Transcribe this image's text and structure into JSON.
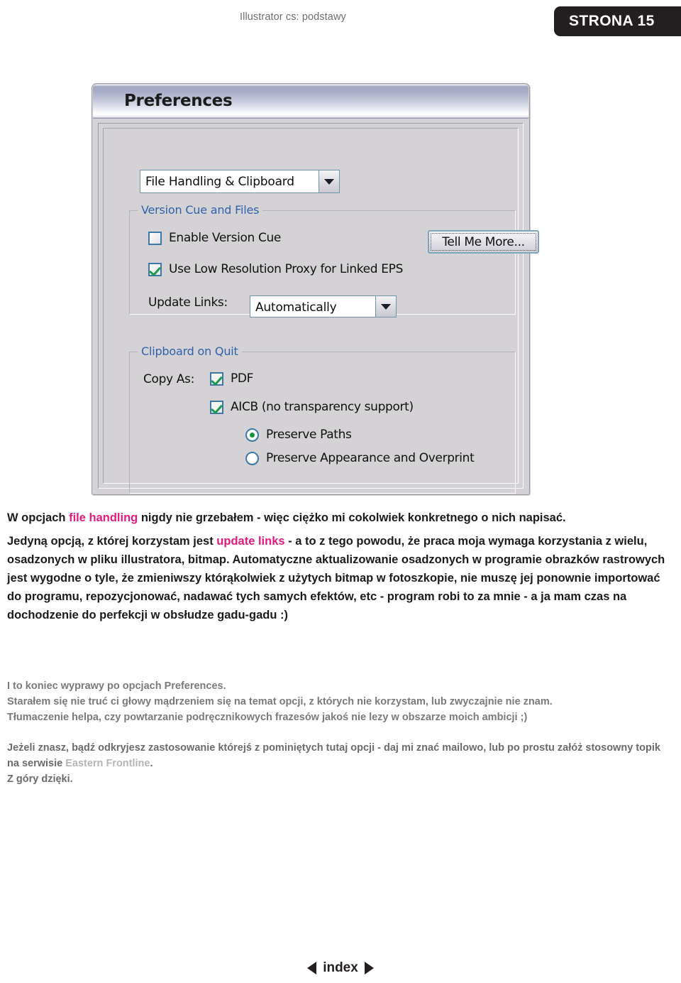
{
  "header": {
    "title": "Illustrator cs: podstawy",
    "page_badge": "STRONA 15"
  },
  "dialog": {
    "title": "Preferences",
    "category_combo": {
      "value": "File Handling & Clipboard",
      "arrow_icon": "chevron-down-icon"
    },
    "groups": [
      {
        "legend": "Version Cue and Files",
        "controls": [
          {
            "type": "checkbox",
            "label": "Enable Version Cue",
            "checked": false
          },
          {
            "type": "checkbox",
            "label": "Use Low Resolution Proxy for Linked EPS",
            "checked": true
          },
          {
            "type": "label",
            "label": "Update Links:"
          }
        ],
        "button": {
          "label": "Tell Me More..."
        },
        "update_links_value": "Automatically"
      },
      {
        "legend": "Clipboard on Quit",
        "copy_as_label": "Copy As:",
        "controls": [
          {
            "type": "checkbox",
            "label": "PDF",
            "checked": true
          },
          {
            "type": "checkbox",
            "label": "AICB (no transparency support)",
            "checked": true
          },
          {
            "type": "radio",
            "label": "Preserve Paths",
            "selected": true
          },
          {
            "type": "radio",
            "label": "Preserve Appearance and Overprint",
            "selected": false
          }
        ]
      }
    ]
  },
  "body": {
    "p1_a": "W opcjach ",
    "p1_link": "file handling",
    "p1_b": " nigdy nie grzebałem - więc ciężko mi cokolwiek konkretnego o nich napisać.",
    "p2_a": "Jedyną opcją, z której korzystam jest ",
    "p2_link": "update links",
    "p2_b": " - a to z tego powodu, że praca moja wymaga korzystania z wielu, osadzonych w pliku illustratora, bitmap. Automatyczne  aktualizowanie osadzonych w programie obrazków rastrowych jest wygodne o tyle, że zmieniwszy którąkolwiek z użytych bitmap w fotoszkopie, nie muszę jej ponownie importować do programu, repozycjonować, nadawać tych samych efektów, etc - program robi to za mnie - a ja mam czas na dochodzenie do perfekcji w obsłudze gadu-gadu :)",
    "p3_l1": "I to koniec wyprawy po opcjach Preferences.",
    "p3_l2": "Starałem się nie truć ci głowy mądrzeniem się na temat opcji, z których nie korzystam, lub zwyczajnie nie znam.",
    "p3_l3": "Tłumaczenie helpa, czy powtarzanie podręcznikowych frazesów jakoś nie lezy w obszarze moich ambicji ;)",
    "p4_a": "Jeżeli znasz, bądź odkryjesz zastosowanie którejś z pominiętych tutaj opcji -  daj mi znać mailowo, lub po prostu załóż stosowny topik na serwisie ",
    "p4_link": "Eastern Frontline",
    "p4_b": ".",
    "p4_c": "Z góry dzięki."
  },
  "footer": {
    "prev_icon": "triangle-left-icon",
    "label": "index",
    "next_icon": "triangle-right-icon"
  },
  "colors": {
    "accent_pink": "#e5197f",
    "group_legend_blue": "#2f62ab",
    "badge_dark": "#231f20"
  }
}
